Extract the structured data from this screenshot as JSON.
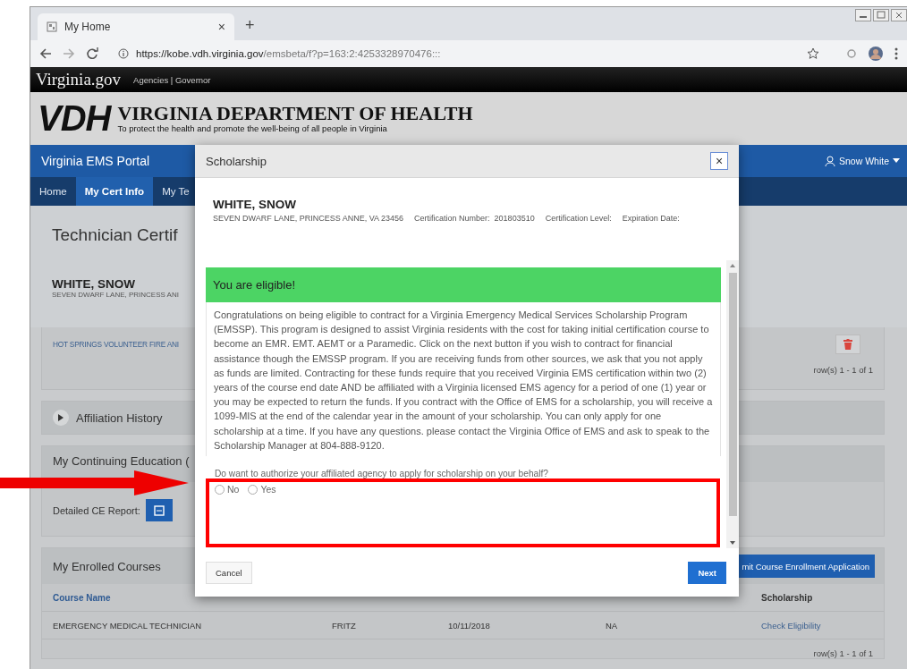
{
  "browser": {
    "tab": {
      "title": "My Home",
      "close": "×"
    },
    "new_tab": "+",
    "url_host": "https://kobe.vdh.virginia.gov",
    "url_path": "/emsbeta/f?p=163:2:4253328970476:::"
  },
  "site_bar": {
    "logo": "Virginia.gov",
    "links": "Agencies | Governor"
  },
  "header": {
    "logo": "VDH",
    "title": "VIRGINIA DEPARTMENT OF HEALTH",
    "tagline": "To protect the health and promote the well-being of all people in Virginia"
  },
  "portal": {
    "title": "Virginia EMS Portal",
    "user": "Snow White"
  },
  "nav": [
    {
      "label": "Home",
      "selected": false
    },
    {
      "label": "My Cert Info",
      "selected": true
    },
    {
      "label": "My Te",
      "selected": false
    }
  ],
  "page": {
    "title": "Technician Certif",
    "name": "WHITE, SNOW",
    "address": "SEVEN DWARF LANE, PRINCESS ANI"
  },
  "affiliations": {
    "agency": "HOT SPRINGS VOLUNTEER FIRE ANI",
    "rows_label": "row(s) 1 - 1 of 1"
  },
  "affiliation_history": {
    "title": "Affiliation History",
    "expanded": false
  },
  "continuing_education": {
    "title": "My Continuing Education (",
    "report_label": "Detailed CE Report:"
  },
  "enrolled_courses": {
    "title": "My Enrolled Courses",
    "button": "mit Course Enrollment Application",
    "columns": [
      "Course Name",
      "",
      "",
      "",
      "Scholarship"
    ],
    "rows": [
      [
        "EMERGENCY MEDICAL TECHNICIAN",
        "FRITZ",
        "10/11/2018",
        "NA",
        "Check Eligibility"
      ]
    ],
    "rows_label": "row(s) 1 - 1 of 1"
  },
  "dialog": {
    "title": "Scholarship",
    "close": "×",
    "name": "WHITE, SNOW",
    "details": [
      "SEVEN DWARF LANE, PRINCESS ANNE, VA 23456",
      "Certification Number:  201803510",
      "Certification Level:",
      "Expiration Date:"
    ],
    "banner": "You are eligible!",
    "message": "Congratulations on being eligible to contract for a Virginia Emergency Medical Services Scholarship Program (EMSSP). This program is designed to assist Virginia residents with the cost for taking initial certification course to become an EMR. EMT. AEMT or a Paramedic. Click on the next button if you wish to contract for financial assistance though the EMSSP program. If you are receiving funds from other sources, we ask that you not apply as funds are limited. Contracting for these funds require that you received Virginia EMS certification within two (2) years of the course end date AND be affiliated with a Virginia licensed EMS agency for a period of one (1) year or you may be expected to return the funds. If you contract with the Office of EMS for a scholarship, you will receive a 1099-MIS at the end of the calendar year in the amount of your scholarship. You can only apply for one scholarship at a time. If you have any questions. please contact the Virginia Office of EMS and ask to speak to the Scholarship Manager at 804-888-9120.",
    "question": "Do want to authorize your affiliated agency to apply for scholarship on your behalf?",
    "options": [
      {
        "label": "No",
        "selected": false
      },
      {
        "label": "Yes",
        "selected": false
      }
    ],
    "buttons": [
      {
        "label": "Cancel",
        "kind": "secondary"
      },
      {
        "label": "Next",
        "kind": "primary"
      }
    ]
  }
}
